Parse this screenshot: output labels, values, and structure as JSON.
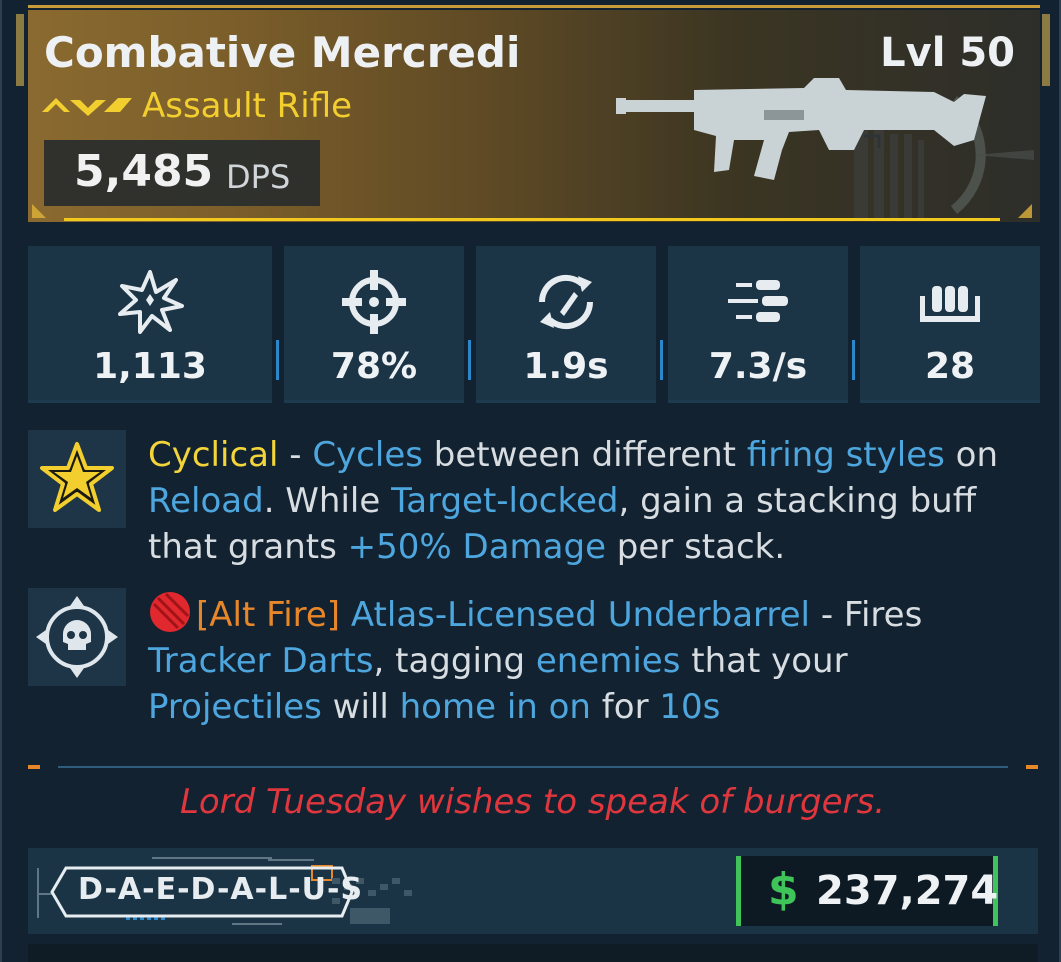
{
  "header": {
    "name": "Combative Mercredi",
    "level": "Lvl 50",
    "type": "Assault Rifle",
    "dps_value": "5,485",
    "dps_label": "DPS"
  },
  "stats": [
    {
      "icon": "damage-burst-icon",
      "value": "1,113"
    },
    {
      "icon": "crosshair-icon",
      "value": "78%"
    },
    {
      "icon": "reload-icon",
      "value": "1.9s"
    },
    {
      "icon": "fire-rate-icon",
      "value": "7.3/s"
    },
    {
      "icon": "magazine-icon",
      "value": "28"
    }
  ],
  "perks": {
    "cyclical": {
      "name": "Cyclical",
      "dash": " - ",
      "w1": "Cycles",
      "t1": " between different ",
      "w2": "firing styles",
      "t2": " on ",
      "w3": "Reload",
      "t3": ". While ",
      "w4": "Target-locked",
      "t4": ", gain a stacking buff that grants ",
      "w5": "+50% Damage",
      "t5": " per stack."
    },
    "altfire": {
      "tag": "[Alt Fire]",
      "space": " ",
      "name": "Atlas-Licensed Underbarrel",
      "t1": " - Fires ",
      "w1": "Tracker Darts",
      "t2": ", tagging ",
      "w2": "enemies",
      "t3": " that your ",
      "w3": "Projectiles",
      "t4": " will ",
      "w4": "home in on",
      "t5": " for ",
      "w5": "10s"
    }
  },
  "flavor_text": "Lord Tuesday wishes to speak of burgers.",
  "manufacturer": "D-A-E-D-A-L-U-S",
  "price": {
    "sign": "$",
    "value": "237,274"
  },
  "colors": {
    "rarity_gold": "#f2cf2e",
    "keyword_blue": "#4ea6de",
    "alt_fire_orange": "#e8872a",
    "flavor_red": "#e0363d",
    "price_green": "#3fc45a"
  }
}
